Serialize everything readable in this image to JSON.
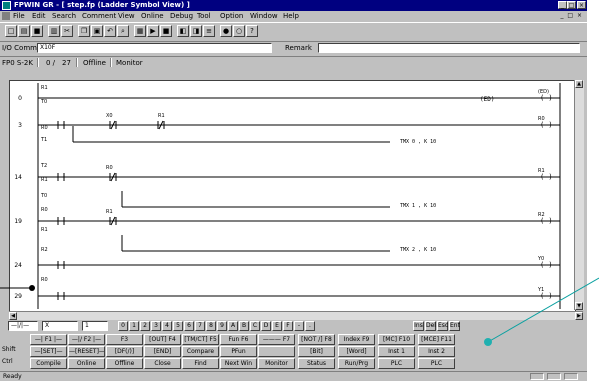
{
  "window": {
    "title": "FPWIN GR - [ step.fp  (Ladder Symbol View) ]",
    "controls": [
      "_",
      "□",
      "×"
    ]
  },
  "menu": [
    "File",
    "Edit",
    "Search",
    "Comment",
    "View",
    "Online",
    "Debug",
    "Tool",
    "Option",
    "Window",
    "Help"
  ],
  "toolbar": {
    "buttons": [
      "new-icon",
      "open-icon",
      "save-icon",
      "print-icon",
      "cut-icon",
      "copy-icon",
      "paste-icon",
      "undo-icon",
      "find-icon",
      "monitor-icon",
      "run-icon",
      "stop-icon",
      "read-icon",
      "write-icon",
      "compare-icon",
      "online-icon",
      "offline-icon",
      "help-icon"
    ]
  },
  "comment_bar": {
    "io_label": "I/O Comment",
    "io_value": "X10F",
    "remark_label": "Remark",
    "remark_value": ""
  },
  "status_row": {
    "items": [
      "FP0 S-2K",
      "0 /",
      "27",
      "Offline",
      "Monitor"
    ]
  },
  "ladder": {
    "rows": [
      {
        "step": "0",
        "contacts": [],
        "coil": "(ED)",
        "annot": ""
      },
      {
        "step": "3",
        "contacts": [
          "X0",
          "R1"
        ],
        "coil": "R0",
        "annot": ""
      },
      {
        "step": "",
        "contacts": [],
        "coil": "",
        "annot": "TMX    0 ,  K    10"
      },
      {
        "step": "14",
        "contacts": [
          "R0"
        ],
        "coil": "R1",
        "annot": "TMX    1 ,  K    10"
      },
      {
        "step": "19",
        "contacts": [
          "R1"
        ],
        "coil": "R2",
        "annot": "TMX    2 ,  K    10"
      },
      {
        "step": "24",
        "contacts": [],
        "coil": "Y0",
        "annot": ""
      },
      {
        "step": "29",
        "contacts": [],
        "coil": "Y1",
        "annot": ""
      }
    ],
    "left_labels": [
      "R1",
      "T0",
      "R0",
      "T1",
      "T2",
      "R1",
      "T0",
      "R0",
      "R1",
      "R2",
      "R0"
    ]
  },
  "palette": {
    "input_symbol": "—|/|—",
    "input_device": "X",
    "input_no": "1",
    "keys": [
      "0",
      "1",
      "2",
      "3",
      "4",
      "5",
      "6",
      "7",
      "8",
      "9",
      "A",
      "B",
      "C",
      "D",
      "E",
      "F",
      "-",
      "."
    ],
    "right": [
      "Ins",
      "Del",
      "Esc",
      "Ent"
    ]
  },
  "function_keys": {
    "row_labels": [
      "Shift",
      "Ctrl"
    ],
    "row1": [
      "—| F1 |—",
      "—|/ F2 |—",
      "F3",
      "[OUT] F4",
      "[TM/CT] F5",
      "Fun F6",
      "——— F7",
      "[NOT /] F8",
      "Index F9",
      "[MC] F10",
      "[MCE] F11"
    ],
    "row2": [
      "—[SET]—",
      "—[RESET]—",
      "[DF(/)]",
      "[END]",
      "Compare",
      "PFun",
      "",
      "[Bit]",
      "[Word]",
      "Inst 1",
      "Inst 2"
    ],
    "row3": [
      "Compile",
      "Online",
      "Offline",
      "Close",
      "Find",
      "Next Win",
      "Monitor",
      "Status",
      "Run/Prg",
      "PLC",
      "PLC"
    ]
  },
  "status_bar": {
    "text": "Ready"
  },
  "accent_colors": {
    "title": "#000080",
    "annotation_line": "#0aa0a0",
    "annotation_dot_teal": "#20b0b0"
  }
}
